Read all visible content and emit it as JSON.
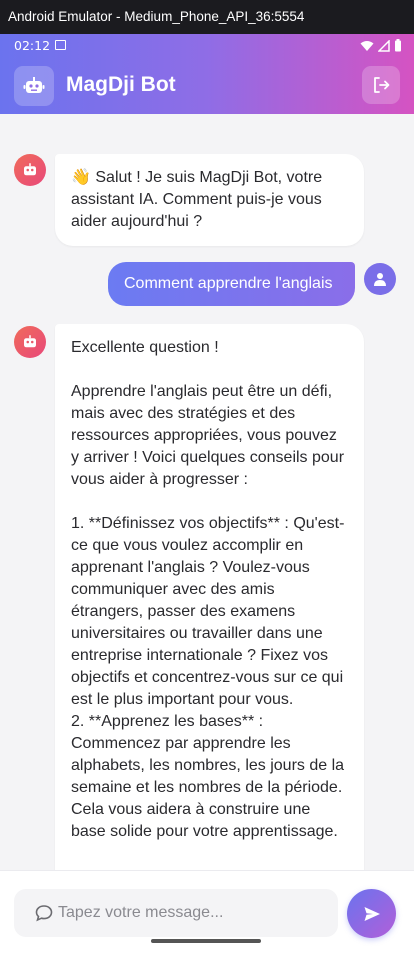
{
  "window": {
    "title": "Android Emulator - Medium_Phone_API_36:5554"
  },
  "statusbar": {
    "time": "02:12"
  },
  "appbar": {
    "title": "MagDji Bot"
  },
  "messages": {
    "bot1": "👋 Salut ! Je suis MagDji Bot, votre assistant IA. Comment puis-je vous aider aujourd'hui ?",
    "user1": "Comment apprendre l'anglais",
    "bot2": "Excellente question !\n\nApprendre l'anglais peut être un défi, mais avec des stratégies et des ressources appropriées, vous pouvez y arriver ! Voici quelques conseils pour vous aider à progresser :\n\n1. **Définissez vos objectifs** : Qu'est-ce que vous voulez accomplir en apprenant l'anglais ? Voulez-vous communiquer avec des amis étrangers, passer des examens universitaires ou travailler dans une entreprise internationale ? Fixez vos objectifs et concentrez-vous sur ce qui est le plus important pour vous.\n2. **Apprenez les bases** : Commencez par apprendre les alphabets, les nombres, les jours de la semaine et les nombres de la période. Cela vous aidera à construire une base solide pour votre apprentissage."
  },
  "composer": {
    "placeholder": "Tapez votre message..."
  },
  "colors": {
    "accent_start": "#6b73ee",
    "accent_end": "#d553c2"
  },
  "icons": [
    "robot-icon",
    "logout-icon",
    "person-icon",
    "chat-bubble-icon",
    "send-icon",
    "wifi-icon",
    "signal-icon",
    "battery-icon"
  ]
}
